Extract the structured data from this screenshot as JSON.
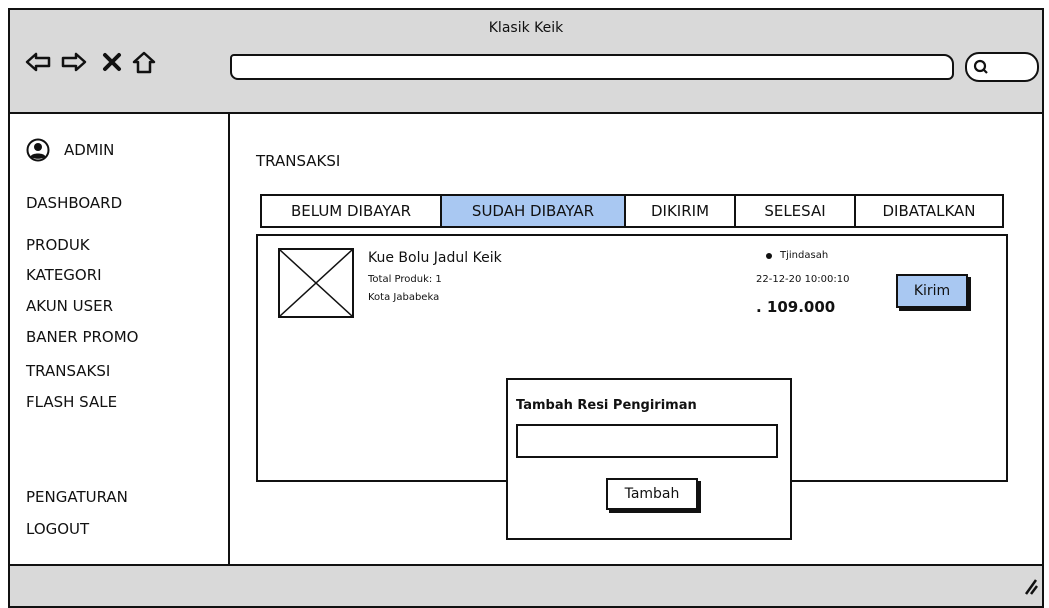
{
  "window": {
    "title": "Klasik Keik"
  },
  "toolbar": {
    "icons": [
      "back-icon",
      "forward-icon",
      "close-icon",
      "home-icon",
      "search-icon"
    ]
  },
  "sidebar": {
    "admin_label": "ADMIN",
    "items": [
      {
        "label": "DASHBOARD"
      },
      {
        "label": "PRODUK"
      },
      {
        "label": "KATEGORI"
      },
      {
        "label": "AKUN USER"
      },
      {
        "label": "BANER PROMO"
      },
      {
        "label": "TRANSAKSI"
      },
      {
        "label": "FLASH SALE"
      }
    ],
    "bottom_items": [
      {
        "label": "PENGATURAN"
      },
      {
        "label": "LOGOUT"
      }
    ]
  },
  "main": {
    "title": "TRANSAKSI",
    "tabs": [
      {
        "label": "BELUM DIBAYAR",
        "active": false
      },
      {
        "label": "SUDAH DIBAYAR",
        "active": true
      },
      {
        "label": "DIKIRIM",
        "active": false
      },
      {
        "label": "SELESAI",
        "active": false
      },
      {
        "label": "DIBATALKAN",
        "active": false
      }
    ]
  },
  "order": {
    "product_name": "Kue Bolu Jadul Keik",
    "total_label": "Total Produk: 1",
    "location": "Kota Jababeka",
    "buyer": "Tjindasah",
    "datetime": "22-12-20  10:00:10",
    "price": ". 109.000",
    "action_label": "Kirim"
  },
  "modal": {
    "title": "Tambah Resi Pengiriman",
    "input_value": "",
    "button_label": "Tambah"
  },
  "colors": {
    "accent": "#a9c8f2",
    "chrome": "#d9d9d9"
  }
}
